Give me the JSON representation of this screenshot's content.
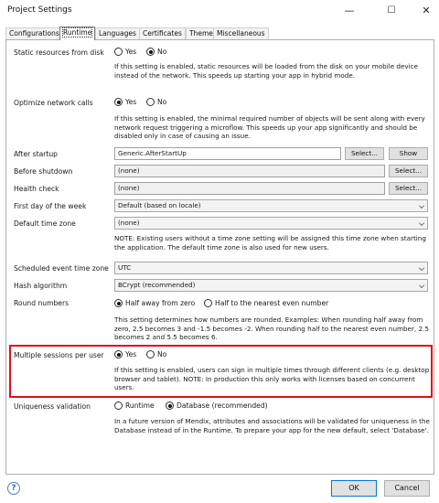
{
  "window": {
    "title": "Project Settings",
    "minimize": "—",
    "maximize": "☐",
    "close": "✕"
  },
  "tabs": [
    {
      "label": "Configurations",
      "active": false
    },
    {
      "label": "Runtime",
      "active": true
    },
    {
      "label": "Languages",
      "active": false
    },
    {
      "label": "Certificates",
      "active": false
    },
    {
      "label": "Theme",
      "active": false
    },
    {
      "label": "Miscellaneous",
      "active": false
    }
  ],
  "settings": {
    "static_resources": {
      "label": "Static resources from disk",
      "yes": "Yes",
      "no": "No",
      "selected": "No",
      "desc": "If this setting is enabled, static resources will be loaded from the disk on your mobile device instead of the network. This speeds up starting your app in hybrid mode."
    },
    "optimize_network": {
      "label": "Optimize network calls",
      "yes": "Yes",
      "no": "No",
      "selected": "Yes",
      "desc": "If this setting is enabled, the minimal required number of objects will be sent along with every network request triggering a microflow. This speeds up your app significantly and should be disabled only in case of causing an issue."
    },
    "after_startup": {
      "label": "After startup",
      "value": "Generic.AfterStartUp",
      "select_btn": "Select...",
      "show_btn": "Show"
    },
    "before_shutdown": {
      "label": "Before shutdown",
      "value": "(none)",
      "select_btn": "Select..."
    },
    "health_check": {
      "label": "Health check",
      "value": "(none)",
      "select_btn": "Select..."
    },
    "first_day": {
      "label": "First day of the week",
      "value": "Default (based on locale)"
    },
    "default_timezone": {
      "label": "Default time zone",
      "value": "(none)",
      "desc": "NOTE: Existing users without a time zone setting will be assigned this time zone when starting the application. The default time zone is also used for new users."
    },
    "scheduled_timezone": {
      "label": "Scheduled event time zone",
      "value": "UTC"
    },
    "hash_algorithm": {
      "label": "Hash algorithm",
      "value": "BCrypt (recommended)"
    },
    "round_numbers": {
      "label": "Round numbers",
      "opt1": "Half away from zero",
      "opt2": "Half to the nearest even number",
      "selected": "Half away from zero",
      "desc": "This setting determines how numbers are rounded. Examples: When rounding half away from zero, 2.5 becomes 3 and -1.5 becomes -2. When rounding half to the nearest even number, 2.5 becomes 2 and 5.5 becomes 6."
    },
    "multiple_sessions": {
      "label": "Multiple sessions per user",
      "yes": "Yes",
      "no": "No",
      "selected": "Yes",
      "desc": "If this setting is enabled, users can sign in multiple times through different clients (e.g. desktop browser and tablet). NOTE: In production this only works with licenses based on concurrent users."
    },
    "uniqueness": {
      "label": "Uniqueness validation",
      "opt1": "Runtime",
      "opt2": "Database (recommended)",
      "selected": "Database (recommended)",
      "desc": "In a future version of Mendix, attributes and associations will be validated for uniqueness in the Database instead of in the Runtime. To prepare your app for the new default, select 'Database'."
    }
  },
  "footer": {
    "help": "?",
    "ok": "OK",
    "cancel": "Cancel"
  },
  "colors": {
    "highlight": "#e0101a",
    "primary_border": "#0078d7"
  }
}
